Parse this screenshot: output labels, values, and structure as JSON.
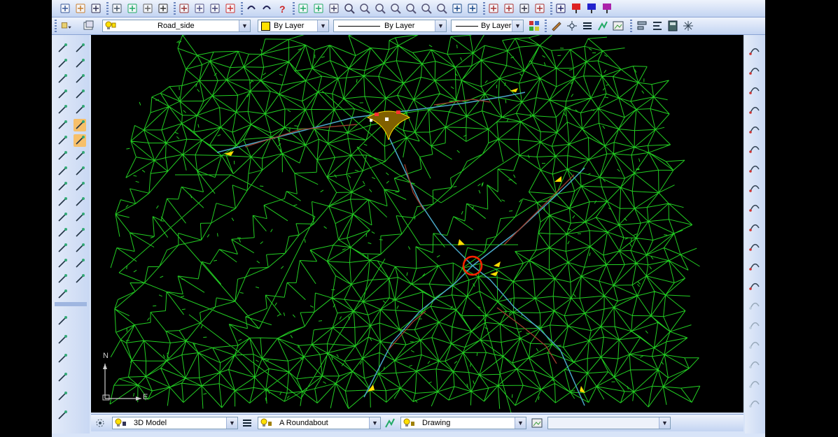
{
  "toolbar_top": {
    "buttons": [
      "new-icon",
      "open-icon",
      "save-icon",
      "pan-icon",
      "properties-icon",
      "preview-icon",
      "plot-icon",
      "cut-icon",
      "copy-icon",
      "paste-icon",
      "matchprop-icon",
      "undo-icon",
      "redo-icon",
      "help-icon",
      "trim-icon",
      "extend-icon",
      "pan-realtime-icon",
      "zoom-realtime-icon",
      "zoom-window-icon",
      "zoom-previous-icon",
      "zoom-in-icon",
      "zoom-out-icon",
      "zoom-extents-icon",
      "zoom-all-icon",
      "view-icon",
      "aerial-icon",
      "layer-state-icon",
      "layout-icon",
      "display-icon",
      "render-icon",
      "copy-layer-icon",
      "flag-red-icon",
      "flag-blue-icon",
      "flag-purple-icon"
    ]
  },
  "toolbar_second": {
    "layer_combo": "Road_side",
    "color_combo": "By Layer",
    "linetype_combo": "By Layer",
    "lineweight_combo": "By Layer"
  },
  "status_bar": {
    "ucs_combo": "3D Model",
    "layer_combo": "A Roundabout",
    "style_combo": "Drawing"
  },
  "canvas": {
    "background": "#000000",
    "mesh_color": "#22cc22",
    "road_color": "#4aa8c8",
    "feature_color": "#a04030",
    "marker_color": "#ffdd00",
    "roundabout_color": "#ff2200",
    "ucs_labels": {
      "north": "N",
      "east": "E"
    }
  }
}
